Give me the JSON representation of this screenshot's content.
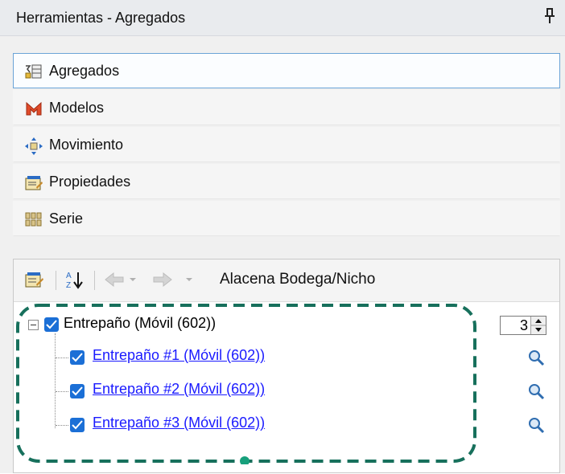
{
  "window": {
    "title": "Herramientas - Agregados",
    "pin_icon": "pin-icon"
  },
  "nav": {
    "items": [
      {
        "label": "Agregados",
        "icon": "aggregates-icon",
        "active": true
      },
      {
        "label": "Modelos",
        "icon": "models-icon",
        "active": false
      },
      {
        "label": "Movimiento",
        "icon": "move-icon",
        "active": false
      },
      {
        "label": "Propiedades",
        "icon": "properties-icon",
        "active": false
      },
      {
        "label": "Serie",
        "icon": "series-icon",
        "active": false
      }
    ]
  },
  "properties": {
    "toolbar": {
      "title": "Alacena Bodega/Nicho",
      "icons": [
        "properties-icon",
        "sort-az-icon",
        "back-arrow-icon",
        "forward-arrow-icon"
      ]
    },
    "tree": {
      "root": {
        "label": "Entrepaño (Móvil (602))",
        "checked": true,
        "count": "3"
      },
      "children": [
        {
          "label": "Entrepaño #1 (Móvil (602))",
          "checked": true
        },
        {
          "label": "Entrepaño #2 (Móvil (602))",
          "checked": true
        },
        {
          "label": "Entrepaño #3 (Móvil (602))",
          "checked": true
        }
      ]
    }
  },
  "colors": {
    "accent": "#1b6fd6",
    "highlight": "#17705c",
    "link": "#1a1aff",
    "active_border": "#6aa3d7"
  }
}
